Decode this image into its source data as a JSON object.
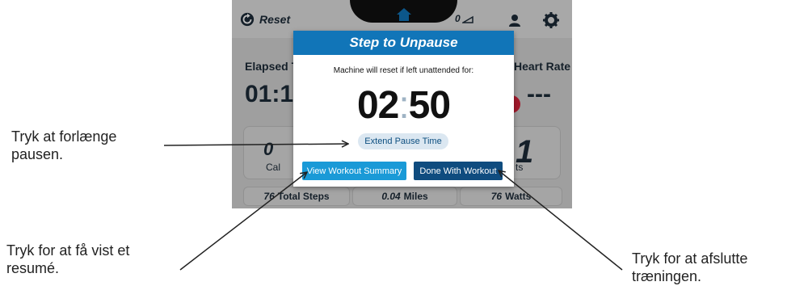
{
  "header": {
    "reset_label": "Reset",
    "incline_value": "0"
  },
  "dashboard": {
    "elapsed_label": "Elapsed Ti",
    "elapsed_value": "01:1",
    "heart_rate_label": "Heart Rate",
    "heart_rate_value": "---",
    "calories_label": "Cal",
    "calories_digit": "0",
    "big_value": "1",
    "watts_tail": "ts",
    "stats": [
      {
        "value": "76",
        "label": "Total Steps"
      },
      {
        "value": "0.04",
        "label": "Miles"
      },
      {
        "value": "76",
        "label": "Watts"
      }
    ]
  },
  "modal": {
    "title": "Step to Unpause",
    "message": "Machine will reset if left unattended for:",
    "minutes": "02",
    "separator": ":",
    "seconds": "50",
    "extend_label": "Extend Pause Time",
    "summary_label": "View Workout Summary",
    "done_label": "Done With Workout"
  },
  "callouts": {
    "extend_line1": "Tryk at forlænge",
    "extend_line2": "pausen.",
    "summary_line1": "Tryk for at få vist et",
    "summary_line2": "resumé.",
    "done_line1": "Tryk for at afslutte",
    "done_line2": "træningen."
  },
  "colors": {
    "modal_header": "#1175b8",
    "summary_button": "#1a9ad7",
    "done_button": "#0f4c7f",
    "heart_rate_accent": "#d9223a"
  }
}
